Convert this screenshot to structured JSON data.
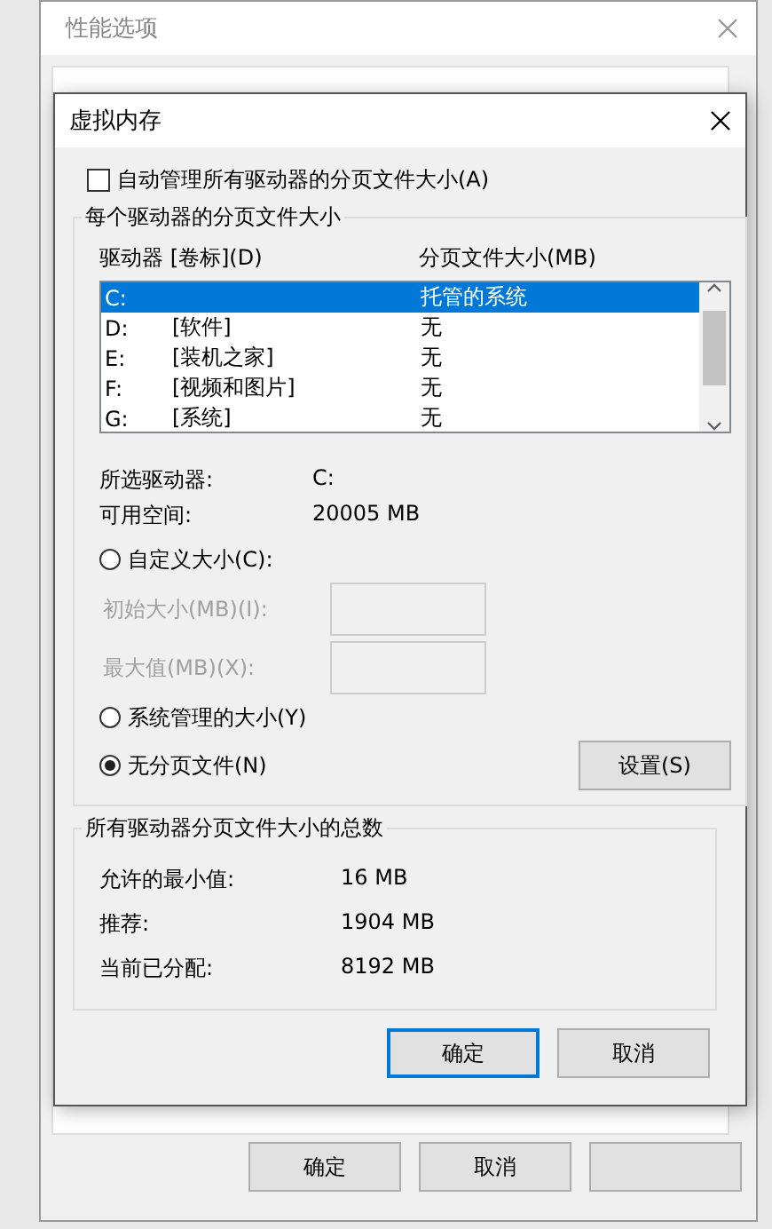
{
  "background_window": {
    "title": "性能选项",
    "buttons": [
      "确定",
      "取消"
    ]
  },
  "dialog": {
    "title": "虚拟内存",
    "auto_manage": {
      "label": "自动管理所有驱动器的分页文件大小(A)",
      "checked": false
    },
    "drives_group": {
      "title": "每个驱动器的分页文件大小",
      "columns": [
        "驱动器 [卷标](D)",
        "分页文件大小(MB)"
      ],
      "drives": [
        {
          "drive": "C:",
          "size": "托管的系统",
          "selected": true
        },
        {
          "drive": "D:",
          "volume": "[软件]",
          "size": "无",
          "selected": false
        },
        {
          "drive": "E:",
          "volume": "[装机之家]",
          "size": "无",
          "selected": false
        },
        {
          "drive": "F:",
          "volume": "[视频和图片]",
          "size": "无",
          "selected": false
        },
        {
          "drive": "G:",
          "volume": "[系统]",
          "size": "无",
          "selected": false
        }
      ],
      "info": [
        {
          "label": "所选驱动器:",
          "value": "C:"
        },
        {
          "label": "可用空间:",
          "value": "20005 MB"
        }
      ],
      "options": [
        {
          "kind": "radio",
          "label": "自定义大小(C):",
          "selected": false
        },
        {
          "kind": "field",
          "label": "初始大小(MB)(I):",
          "disabled": true
        },
        {
          "kind": "field",
          "label": "最大值(MB)(X):",
          "disabled": true
        },
        {
          "kind": "radio",
          "label": "系统管理的大小(Y)",
          "selected": false
        },
        {
          "kind": "radio",
          "label": "无分页文件(N)",
          "selected": true
        }
      ],
      "set_button": "设置(S)"
    },
    "totals_group": {
      "title": "所有驱动器分页文件大小的总数",
      "rows": [
        {
          "label": "允许的最小值:",
          "value": "16 MB"
        },
        {
          "label": "推荐:",
          "value": "1904 MB"
        },
        {
          "label": "当前已分配:",
          "value": "8192 MB"
        }
      ]
    },
    "buttons": [
      {
        "label": "确定",
        "default": true
      },
      {
        "label": "取消",
        "default": false
      }
    ]
  }
}
